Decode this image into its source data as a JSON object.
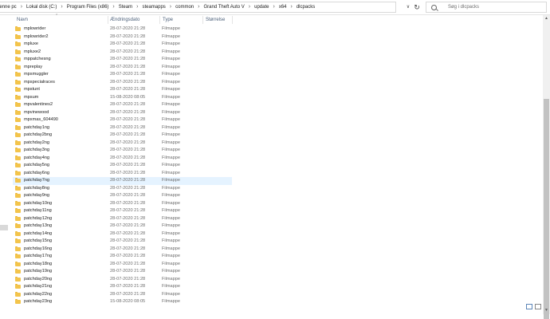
{
  "breadcrumb": [
    "Denne pc",
    "Lokal disk (C:)",
    "Program Files (x86)",
    "Steam",
    "steamapps",
    "common",
    "Grand Theft Auto V",
    "update",
    "x64",
    "dlcpacks"
  ],
  "search": {
    "placeholder": "Søg i dlcpacks"
  },
  "columns": {
    "name": "Navn",
    "date": "Ændringsdato",
    "type": "Type",
    "size": "Størrelse"
  },
  "rows": [
    {
      "name": "mplowrider",
      "date": "28-07-2020 21:28",
      "type": "Filmappe"
    },
    {
      "name": "mplowrider2",
      "date": "28-07-2020 21:28",
      "type": "Filmappe"
    },
    {
      "name": "mpluxe",
      "date": "28-07-2020 21:28",
      "type": "Filmappe"
    },
    {
      "name": "mpluxe2",
      "date": "28-07-2020 21:28",
      "type": "Filmappe"
    },
    {
      "name": "mppatchesng",
      "date": "28-07-2020 21:28",
      "type": "Filmappe"
    },
    {
      "name": "mpreplay",
      "date": "28-07-2020 21:28",
      "type": "Filmappe"
    },
    {
      "name": "mpsmuggler",
      "date": "28-07-2020 21:28",
      "type": "Filmappe"
    },
    {
      "name": "mpspecialraces",
      "date": "28-07-2020 21:28",
      "type": "Filmappe"
    },
    {
      "name": "mpstunt",
      "date": "28-07-2020 21:28",
      "type": "Filmappe"
    },
    {
      "name": "mpsum",
      "date": "15-08-2020 08:05",
      "type": "Filmappe"
    },
    {
      "name": "mpvalentines2",
      "date": "28-07-2020 21:28",
      "type": "Filmappe"
    },
    {
      "name": "mpvinewood",
      "date": "28-07-2020 21:28",
      "type": "Filmappe"
    },
    {
      "name": "mpxmas_604490",
      "date": "28-07-2020 21:28",
      "type": "Filmappe"
    },
    {
      "name": "patchday1ng",
      "date": "28-07-2020 21:28",
      "type": "Filmappe"
    },
    {
      "name": "patchday2bng",
      "date": "28-07-2020 21:28",
      "type": "Filmappe"
    },
    {
      "name": "patchday2ng",
      "date": "28-07-2020 21:28",
      "type": "Filmappe"
    },
    {
      "name": "patchday3ng",
      "date": "28-07-2020 21:28",
      "type": "Filmappe"
    },
    {
      "name": "patchday4ng",
      "date": "28-07-2020 21:28",
      "type": "Filmappe"
    },
    {
      "name": "patchday5ng",
      "date": "28-07-2020 21:28",
      "type": "Filmappe"
    },
    {
      "name": "patchday6ng",
      "date": "28-07-2020 21:28",
      "type": "Filmappe"
    },
    {
      "name": "patchday7ng",
      "date": "28-07-2020 21:28",
      "type": "Filmappe",
      "selected": true
    },
    {
      "name": "patchday8ng",
      "date": "28-07-2020 21:28",
      "type": "Filmappe"
    },
    {
      "name": "patchday9ng",
      "date": "28-07-2020 21:28",
      "type": "Filmappe"
    },
    {
      "name": "patchday10ng",
      "date": "28-07-2020 21:28",
      "type": "Filmappe"
    },
    {
      "name": "patchday11ng",
      "date": "28-07-2020 21:28",
      "type": "Filmappe"
    },
    {
      "name": "patchday12ng",
      "date": "28-07-2020 21:28",
      "type": "Filmappe"
    },
    {
      "name": "patchday13ng",
      "date": "28-07-2020 21:28",
      "type": "Filmappe"
    },
    {
      "name": "patchday14ng",
      "date": "28-07-2020 21:28",
      "type": "Filmappe"
    },
    {
      "name": "patchday15ng",
      "date": "28-07-2020 21:28",
      "type": "Filmappe"
    },
    {
      "name": "patchday16ng",
      "date": "28-07-2020 21:28",
      "type": "Filmappe"
    },
    {
      "name": "patchday17ng",
      "date": "28-07-2020 21:28",
      "type": "Filmappe"
    },
    {
      "name": "patchday18ng",
      "date": "28-07-2020 21:28",
      "type": "Filmappe"
    },
    {
      "name": "patchday19ng",
      "date": "28-07-2020 21:28",
      "type": "Filmappe"
    },
    {
      "name": "patchday20ng",
      "date": "28-07-2020 21:28",
      "type": "Filmappe"
    },
    {
      "name": "patchday21ng",
      "date": "28-07-2020 21:28",
      "type": "Filmappe"
    },
    {
      "name": "patchday22ng",
      "date": "28-07-2020 21:28",
      "type": "Filmappe"
    },
    {
      "name": "patchday23ng",
      "date": "15-08-2020 08:05",
      "type": "Filmappe"
    }
  ],
  "icons": {
    "folder": "folder-icon",
    "search": "search-icon",
    "refresh": "refresh-icon",
    "dropdown": "chevron-down-icon"
  },
  "colors": {
    "folder": "#f3c44b",
    "selection": "#e5f3ff",
    "header_text": "#4c607a"
  }
}
